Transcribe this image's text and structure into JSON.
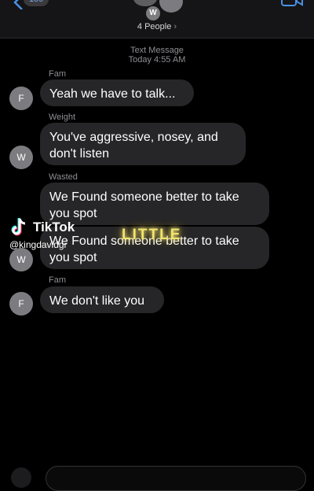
{
  "header": {
    "back_badge": "189",
    "group_title": "4 People",
    "avatar_initial": "W"
  },
  "conversation": {
    "service": "Text Message",
    "time": "Today 4:55 AM"
  },
  "messages": [
    {
      "sender": "Fam",
      "initial": "F",
      "lines": [
        "Yeah we have to talk..."
      ]
    },
    {
      "sender": "Weight",
      "initial": "W",
      "lines": [
        "You've aggressive, nosey, and",
        "don't listen"
      ]
    },
    {
      "sender": "Wasted",
      "initial": "",
      "lines": [
        "We Found someone better to take",
        "you spot"
      ]
    },
    {
      "sender": "",
      "initial": "W",
      "lines": [
        "We Found someone better to take",
        "you spot"
      ]
    },
    {
      "sender": "Fam",
      "initial": "F",
      "lines": [
        "We don't like you"
      ]
    }
  ],
  "overlay": {
    "brand": "TikTok",
    "username": "@kingdavidgr",
    "caption": "LITTLE"
  }
}
